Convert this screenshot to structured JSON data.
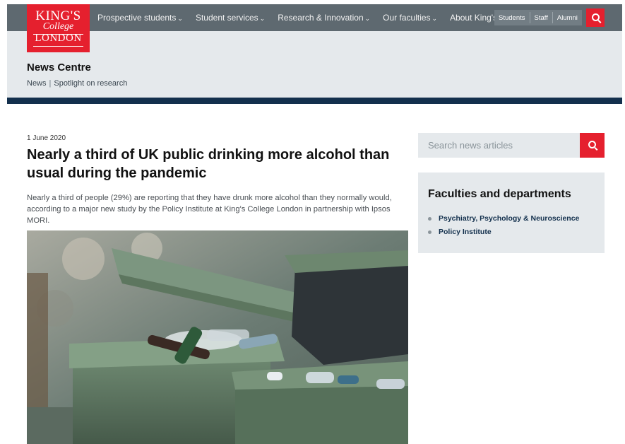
{
  "logo": {
    "line1": "KING'S",
    "line2": "College",
    "line3": "LONDON"
  },
  "nav": {
    "items": [
      {
        "label": "Prospective students"
      },
      {
        "label": "Student services"
      },
      {
        "label": "Research & Innovation"
      },
      {
        "label": "Our faculties"
      },
      {
        "label": "About King's"
      }
    ],
    "chevron": "⌄",
    "audience": [
      "Students",
      "Staff",
      "Alumni"
    ]
  },
  "band": {
    "title": "News Centre",
    "breadcrumb": [
      "News",
      "Spotlight on research"
    ]
  },
  "article": {
    "date": "1 June 2020",
    "title": "Nearly a third of UK public drinking more alcohol than usual during the pandemic",
    "lead": "Nearly a third of people (29%) are reporting that they have drunk more alcohol than they normally would, according to a major new study by the Policy Institute at King's College London in partnership with Ipsos MORI."
  },
  "sidebar": {
    "search_placeholder": "Search news articles",
    "faculties_title": "Faculties and departments",
    "faculties": [
      "Psychiatry, Psychology & Neuroscience",
      "Policy Institute"
    ]
  },
  "colors": {
    "brand_red": "#e5202e",
    "nav_grey": "#5e6970",
    "navy": "#13304d",
    "panel_grey": "#e5e9ec"
  },
  "icons": {
    "search": "search-icon",
    "chevron": "chevron-down-icon"
  }
}
